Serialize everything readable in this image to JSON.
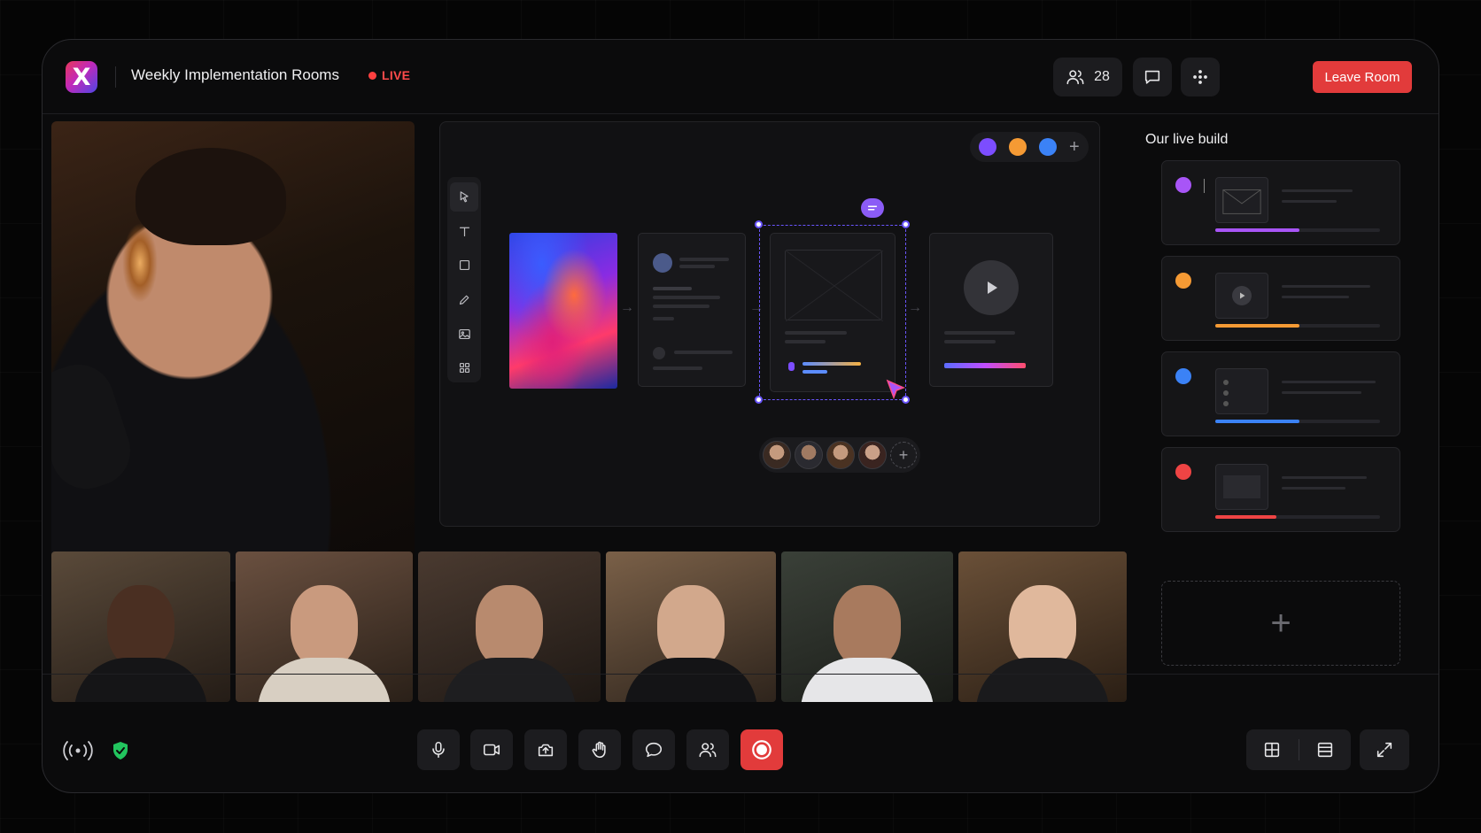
{
  "header": {
    "logo_letter": "X",
    "room_title": "Weekly Implementation Rooms",
    "live_label": "LIVE",
    "participants_count": "28",
    "leave_label": "Leave Room"
  },
  "board": {
    "colors": [
      "#7c4dff",
      "#f59a34",
      "#3b82f6"
    ],
    "add_color": "+",
    "add_avatar": "+"
  },
  "panel": {
    "title": "Our live build",
    "cards": [
      {
        "color": "#a855f7",
        "progress": 0.51
      },
      {
        "color": "#f59a34",
        "progress": 0.51
      },
      {
        "color": "#3b82f6",
        "progress": 0.51
      },
      {
        "color": "#ef4444",
        "progress": 0.37
      }
    ],
    "add_label": "+"
  },
  "colors": {
    "accent_danger": "#e23b3b",
    "live": "#ff4b4b",
    "selection": "#6a55ff",
    "secure": "#22c55e"
  }
}
